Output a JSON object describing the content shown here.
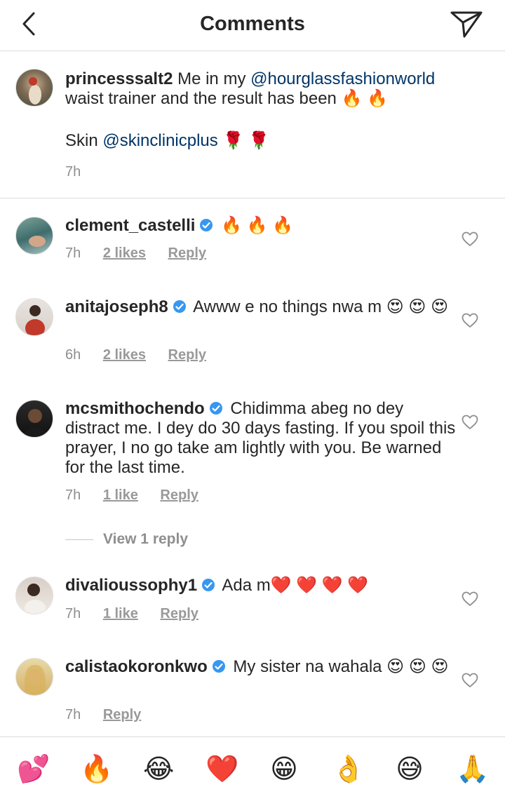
{
  "header": {
    "title": "Comments"
  },
  "caption": {
    "username": "princesssalt2",
    "text_1": "Me in my ",
    "mention_1": "@hourglassfashionworld",
    "text_2": " waist trainer and the result has been 🔥 🔥",
    "text_3": "Skin ",
    "mention_2": "@skinclinicplus",
    "text_4": " 🌹 🌹",
    "time": "7h"
  },
  "comments": [
    {
      "username": "clement_castelli",
      "text": "🔥 🔥 🔥",
      "time": "7h",
      "likes": "2 likes",
      "reply": "Reply"
    },
    {
      "username": "anitajoseph8",
      "text": "Awww e no things nwa m 😍 😍 😍",
      "time": "6h",
      "likes": "2 likes",
      "reply": "Reply"
    },
    {
      "username": "mcsmithochendo",
      "text": "Chidimma abeg no dey distract me. I dey do 30 days fasting. If you spoil this prayer, I no go take am lightly with you. Be warned for the last time.",
      "time": "7h",
      "likes": "1 like",
      "reply": "Reply"
    },
    {
      "username": "divalioussophy1",
      "text": "Ada m❤️ ❤️ ❤️ ❤️",
      "time": "7h",
      "likes": "1 like",
      "reply": "Reply"
    },
    {
      "username": "calistaokoronkwo",
      "text": "My sister  na wahala 😍 😍 😍",
      "time": "7h",
      "likes": "",
      "reply": "Reply"
    }
  ],
  "view_replies": "View 1 reply",
  "emoji_bar": [
    "💕",
    "🔥",
    "😂",
    "❤️",
    "😁",
    "👌",
    "😅",
    "🙏"
  ],
  "colors": {
    "verified": "#3897f0",
    "mention": "#003569",
    "meta": "#8e8e8e",
    "divider": "#dbdbdb"
  }
}
